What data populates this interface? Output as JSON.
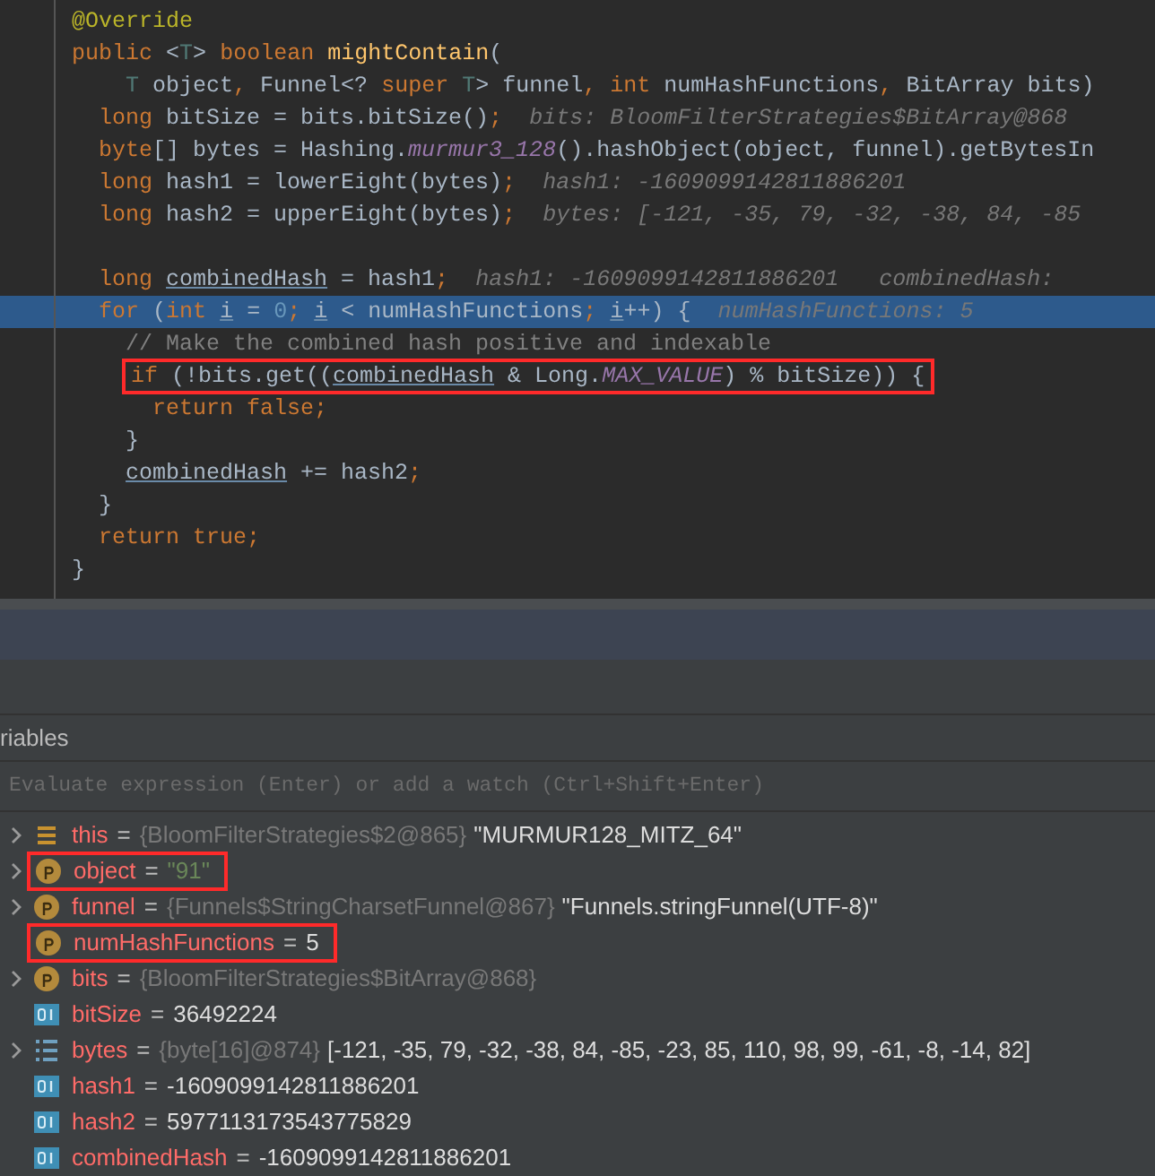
{
  "code_lines": [
    {
      "highlighted": false,
      "boxed": false,
      "segments": [
        {
          "text": "@Override",
          "kind": "annotation"
        }
      ]
    },
    {
      "highlighted": false,
      "boxed": false,
      "segments": [
        {
          "text": "public ",
          "kind": "keyword"
        },
        {
          "text": "<",
          "kind": "plain"
        },
        {
          "text": "T",
          "kind": "type"
        },
        {
          "text": "> ",
          "kind": "plain"
        },
        {
          "text": "boolean ",
          "kind": "keyword"
        },
        {
          "text": "mightContain",
          "kind": "method"
        },
        {
          "text": "(",
          "kind": "plain"
        }
      ]
    },
    {
      "highlighted": false,
      "boxed": false,
      "segments": [
        {
          "text": "    T ",
          "kind": "type"
        },
        {
          "text": "object",
          "kind": "plain"
        },
        {
          "text": ", ",
          "kind": "keyword"
        },
        {
          "text": "Funnel<? ",
          "kind": "plain"
        },
        {
          "text": "super ",
          "kind": "keyword"
        },
        {
          "text": "T",
          "kind": "type"
        },
        {
          "text": "> funnel",
          "kind": "plain"
        },
        {
          "text": ", ",
          "kind": "keyword"
        },
        {
          "text": "int ",
          "kind": "keyword"
        },
        {
          "text": "numHashFunctions",
          "kind": "plain"
        },
        {
          "text": ", ",
          "kind": "keyword"
        },
        {
          "text": "BitArray bits)",
          "kind": "plain"
        }
      ]
    },
    {
      "highlighted": false,
      "boxed": false,
      "segments": [
        {
          "text": "  long ",
          "kind": "keyword"
        },
        {
          "text": "bitSize = bits.bitSize()",
          "kind": "plain"
        },
        {
          "text": ";",
          "kind": "keyword"
        },
        {
          "text": "  bits: BloomFilterStrategies$BitArray@868",
          "kind": "hint"
        }
      ]
    },
    {
      "highlighted": false,
      "boxed": false,
      "segments": [
        {
          "text": "  byte",
          "kind": "keyword"
        },
        {
          "text": "[] bytes = Hashing.",
          "kind": "plain"
        },
        {
          "text": "murmur3_128",
          "kind": "static"
        },
        {
          "text": "().hashObject(object, funnel).getBytesIn",
          "kind": "plain"
        }
      ]
    },
    {
      "highlighted": false,
      "boxed": false,
      "segments": [
        {
          "text": "  long ",
          "kind": "keyword"
        },
        {
          "text": "hash1 = lowerEight(bytes)",
          "kind": "plain"
        },
        {
          "text": ";",
          "kind": "keyword"
        },
        {
          "text": "  hash1: -1609099142811886201",
          "kind": "hint"
        }
      ]
    },
    {
      "highlighted": false,
      "boxed": false,
      "segments": [
        {
          "text": "  long ",
          "kind": "keyword"
        },
        {
          "text": "hash2 = upperEight(bytes)",
          "kind": "plain"
        },
        {
          "text": ";",
          "kind": "keyword"
        },
        {
          "text": "  bytes: [-121, -35, 79, -32, -38, 84, -85",
          "kind": "hint"
        }
      ]
    },
    {
      "highlighted": false
    },
    {
      "highlighted": false,
      "boxed": false,
      "segments": [
        {
          "text": "  long ",
          "kind": "keyword"
        },
        {
          "text": "combinedHash",
          "kind": "underlined"
        },
        {
          "text": " = hash1",
          "kind": "plain"
        },
        {
          "text": ";",
          "kind": "keyword"
        },
        {
          "text": "  hash1: -1609099142811886201   combinedHash:",
          "kind": "hint"
        }
      ]
    },
    {
      "highlighted": true,
      "boxed": false,
      "segments": [
        {
          "text": "  for ",
          "kind": "keyword"
        },
        {
          "text": "(",
          "kind": "plain"
        },
        {
          "text": "int ",
          "kind": "keyword"
        },
        {
          "text": "i",
          "kind": "underlined"
        },
        {
          "text": " = ",
          "kind": "plain"
        },
        {
          "text": "0",
          "kind": "number"
        },
        {
          "text": "; ",
          "kind": "keyword"
        },
        {
          "text": "i",
          "kind": "underlined"
        },
        {
          "text": " < numHashFunctions",
          "kind": "plain"
        },
        {
          "text": "; ",
          "kind": "keyword"
        },
        {
          "text": "i",
          "kind": "underlined"
        },
        {
          "text": "++) {",
          "kind": "plain"
        },
        {
          "text": "  numHashFunctions: 5",
          "kind": "hint"
        }
      ]
    },
    {
      "highlighted": false,
      "boxed": false,
      "segments": [
        {
          "text": "    // Make the combined hash positive and indexable",
          "kind": "comment"
        }
      ]
    },
    {
      "highlighted": false,
      "boxed": true,
      "segments": [
        {
          "text": "if ",
          "kind": "keyword"
        },
        {
          "text": "(!bits.get((",
          "kind": "plain"
        },
        {
          "text": "combinedHash",
          "kind": "underlined"
        },
        {
          "text": " & Long.",
          "kind": "plain"
        },
        {
          "text": "MAX_VALUE",
          "kind": "static"
        },
        {
          "text": ") % bitSize)) {",
          "kind": "plain"
        }
      ]
    },
    {
      "highlighted": false,
      "boxed": false,
      "segments": [
        {
          "text": "      return false",
          "kind": "keyword"
        },
        {
          "text": ";",
          "kind": "keyword"
        }
      ]
    },
    {
      "highlighted": false,
      "boxed": false,
      "segments": [
        {
          "text": "    }",
          "kind": "plain"
        }
      ]
    },
    {
      "highlighted": false,
      "boxed": false,
      "segments": [
        {
          "text": "    combinedHash",
          "kind": "underlined"
        },
        {
          "text": " += hash2",
          "kind": "plain"
        },
        {
          "text": ";",
          "kind": "keyword"
        }
      ]
    },
    {
      "highlighted": false,
      "boxed": false,
      "segments": [
        {
          "text": "  }",
          "kind": "plain"
        }
      ]
    },
    {
      "highlighted": false,
      "boxed": false,
      "segments": [
        {
          "text": "  return true",
          "kind": "keyword"
        },
        {
          "text": ";",
          "kind": "keyword"
        }
      ]
    },
    {
      "highlighted": false,
      "boxed": false,
      "segments": [
        {
          "text": "}",
          "kind": "plain"
        }
      ]
    }
  ],
  "variables_panel": {
    "title": "riables",
    "evaluate_placeholder": "Evaluate expression (Enter) or add a watch (Ctrl+Shift+Enter)",
    "variables": [
      {
        "kind": "this",
        "expandable": true,
        "boxed": false,
        "name": "this",
        "operator": "=",
        "ref": "{BloomFilterStrategies$2@865}",
        "value": "\"MURMUR128_MITZ_64\"",
        "is_string": false
      },
      {
        "kind": "param",
        "expandable": true,
        "boxed": true,
        "name": "object",
        "operator": "=",
        "value": "\"91\"",
        "is_string": true
      },
      {
        "kind": "param",
        "expandable": true,
        "boxed": false,
        "name": "funnel",
        "operator": "=",
        "ref": "{Funnels$StringCharsetFunnel@867}",
        "value": "\"Funnels.stringFunnel(UTF-8)\"",
        "is_string": false
      },
      {
        "kind": "param",
        "expandable": false,
        "boxed": true,
        "name": "numHashFunctions",
        "operator": "=",
        "value": "5",
        "is_string": false
      },
      {
        "kind": "param",
        "expandable": true,
        "boxed": false,
        "name": "bits",
        "operator": "=",
        "ref": "{BloomFilterStrategies$BitArray@868}"
      },
      {
        "kind": "primitive",
        "expandable": false,
        "boxed": false,
        "name": "bitSize",
        "operator": "=",
        "value": "36492224",
        "is_string": false
      },
      {
        "kind": "array",
        "expandable": true,
        "boxed": false,
        "name": "bytes",
        "ref": "{byte[16]@874}",
        "value": "[-121, -35, 79, -32, -38, 84, -85, -23, 85, 110, 98, 99, -61, -8, -14, 82]",
        "operator": "=",
        "is_string": false
      },
      {
        "kind": "primitive",
        "expandable": false,
        "boxed": false,
        "name": "hash1",
        "operator": "=",
        "value": "-1609099142811886201",
        "is_string": false
      },
      {
        "kind": "primitive",
        "expandable": false,
        "boxed": false,
        "name": "hash2",
        "operator": "=",
        "value": "5977113173543775829",
        "is_string": false
      },
      {
        "kind": "primitive",
        "expandable": false,
        "boxed": false,
        "name": "combinedHash",
        "operator": "=",
        "value": "-1609099142811886201",
        "is_string": false
      }
    ]
  }
}
